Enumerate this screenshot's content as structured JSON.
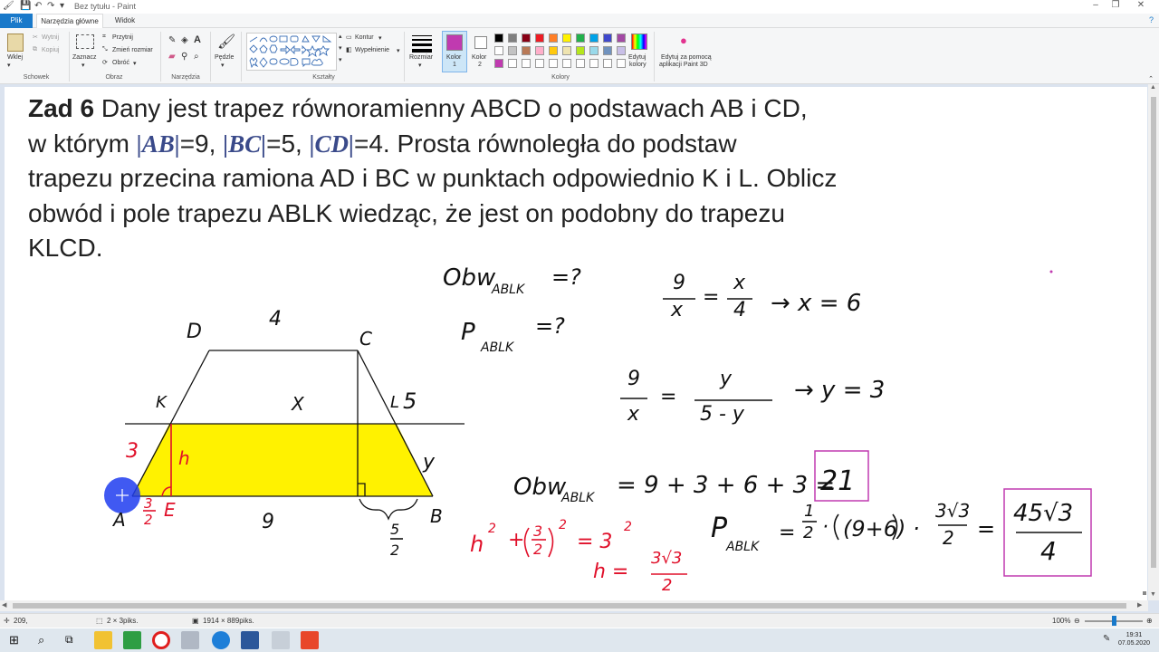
{
  "window": {
    "title": "Bez tytułu - Paint",
    "controls": [
      "–",
      "❐",
      "✕"
    ]
  },
  "tabs": [
    {
      "label": "Plik"
    },
    {
      "label": "Narzędzia główne"
    },
    {
      "label": "Widok"
    }
  ],
  "ribbon": {
    "clipboard": {
      "paste": "Wklej",
      "cut": "Wytnij",
      "copy": "Kopiuj",
      "group": "Schowek"
    },
    "image": {
      "select": "Zaznacz",
      "crop": "Przytnij",
      "resize": "Zmień rozmiar",
      "rotate": "Obróć",
      "group": "Obraz"
    },
    "tools": {
      "group": "Narzędzia"
    },
    "brushes": {
      "label": "Pędzle"
    },
    "shapes": {
      "outline": "Kontur",
      "fill": "Wypełnienie",
      "group": "Kształty"
    },
    "size": {
      "label": "Rozmiar"
    },
    "color1": {
      "label_a": "Kolor",
      "label_b": "1",
      "value": "#c03ab0"
    },
    "color2": {
      "label_a": "Kolor",
      "label_b": "2",
      "value": "#ffffff"
    },
    "palette_group": "Kolory",
    "edit_colors_a": "Edytuj",
    "edit_colors_b": "kolory",
    "paint3d_a": "Edytuj za pomocą",
    "paint3d_b": "aplikacji Paint 3D",
    "palette_row1": [
      "#000000",
      "#7f7f7f",
      "#880015",
      "#ed1c24",
      "#ff7f27",
      "#fff200",
      "#22b14c",
      "#00a2e8",
      "#3f48cc",
      "#a349a4"
    ],
    "palette_row2": [
      "#ffffff",
      "#c3c3c3",
      "#b97a57",
      "#ffaec9",
      "#ffc90e",
      "#efe4b0",
      "#b5e61d",
      "#99d9ea",
      "#7092be",
      "#c8bfe7"
    ],
    "palette_row3": [
      "#c03ab0",
      "#ffffff",
      "#ffffff",
      "#ffffff",
      "#ffffff",
      "#ffffff",
      "#ffffff",
      "#ffffff",
      "#ffffff",
      "#ffffff"
    ]
  },
  "problem": {
    "title": "Zad 6",
    "line1": " Dany jest trapez równoramienny ABCD  o podstawach AB i CD,",
    "line2_a": "w którym ",
    "ab": "|AB|",
    "line2_b": "=9, ",
    "bc": "|BC|",
    "line2_c": "=5, ",
    "cd": "|CD|",
    "line2_d": "=4. Prosta równoległa do podstaw",
    "line3": "trapezu przecina ramiona AD i BC w punktach odpowiednio K i L. Oblicz",
    "line4": "obwód i pole trapezu ABLK wiedząc, że jest on podobny do trapezu",
    "line5": "KLCD."
  },
  "handwriting": {
    "obw_q": "Obw",
    "obw_q_sub": "ABLK",
    "obw_q_tail": "=?",
    "p_q": "P",
    "p_q_sub": "ABLK",
    "p_q_tail": "=?",
    "ratio1_num_a": "9",
    "ratio1_den_a": "x",
    "ratio1_num_b": "x",
    "ratio1_den_b": "4",
    "ratio1_result": "→  x = 6",
    "ratio2_num_a": "9",
    "ratio2_den_a": "x",
    "ratio2_num_b": "y",
    "ratio2_den_b": "5 - y",
    "ratio2_result": "→  y = 3",
    "obw_calc": "Obw",
    "obw_calc_sub": "ABLK",
    "obw_calc_expr": "= 9 + 3 + 6 + 3 =",
    "obw_answer": "21",
    "pole_calc": "P",
    "pole_calc_sub": "ABLK",
    "pole_half_num": "1",
    "pole_half_den": "2",
    "pole_mid": "(9+6) ·",
    "pole_h_num": "3√3",
    "pole_h_den": "2",
    "pole_answer_num": "45√3",
    "pole_answer_den": "4",
    "pyth_h": "h",
    "pyth_frac_num": "3",
    "pyth_frac_den": "2",
    "pyth_rest": "= 3",
    "h_eq": "h =",
    "h_num": "3√3",
    "h_den": "2"
  },
  "figure": {
    "label_D": "D",
    "label_C": "C",
    "label_top": "4",
    "label_K": "K",
    "label_X": "X",
    "label_L": "L",
    "label_5": "5",
    "label_3": "3",
    "label_h": "h",
    "label_y": "y",
    "label_A": "A",
    "label_E": "E",
    "label_9": "9",
    "label_B": "B",
    "label_32_num": "3",
    "label_32_den": "2",
    "label_52_num": "5",
    "label_52_den": "2",
    "fill_color": "#fff200"
  },
  "status": {
    "cursor": "209,",
    "selection": "2 × 3piks.",
    "image_size": "1914 × 889piks.",
    "zoom": "100%"
  },
  "taskbar": {
    "time": "19:31",
    "date": "07.05.2020"
  }
}
